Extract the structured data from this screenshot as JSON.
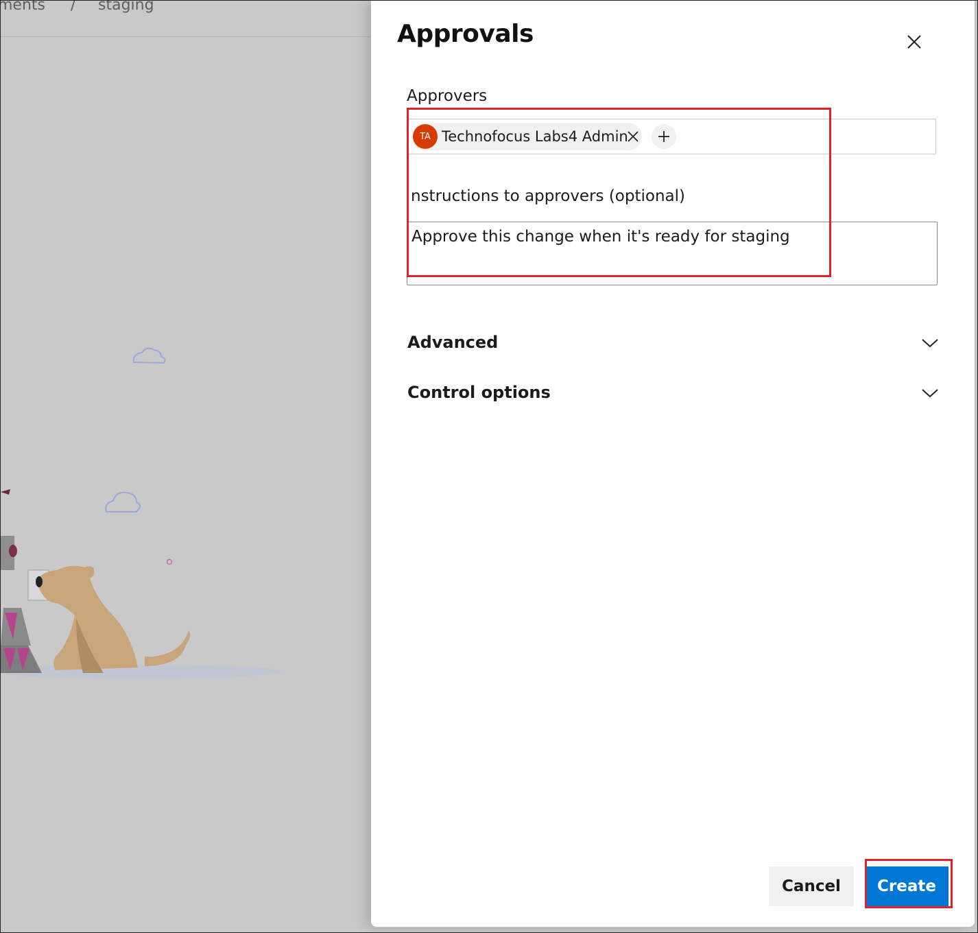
{
  "breadcrumb": {
    "items": [
      "ments",
      "staging"
    ],
    "separator": "/"
  },
  "dialog": {
    "title": "Approvals",
    "close_icon": "close-icon"
  },
  "approvers": {
    "label": "Approvers",
    "chips": [
      {
        "initials": "TA",
        "name": "Technofocus Labs4 Admin",
        "avatar_color": "#d83b01"
      }
    ],
    "add_icon": "plus-icon"
  },
  "instructions": {
    "label": "nstructions to approvers (optional)",
    "value": "Approve this change when it's ready for staging"
  },
  "sections": {
    "advanced": "Advanced",
    "control_options": "Control options"
  },
  "footer": {
    "cancel_label": "Cancel",
    "create_label": "Create"
  },
  "colors": {
    "primary": "#0078d4",
    "highlight": "#e0202a",
    "avatar": "#d83b01",
    "overlay": "#c9c9c9"
  }
}
